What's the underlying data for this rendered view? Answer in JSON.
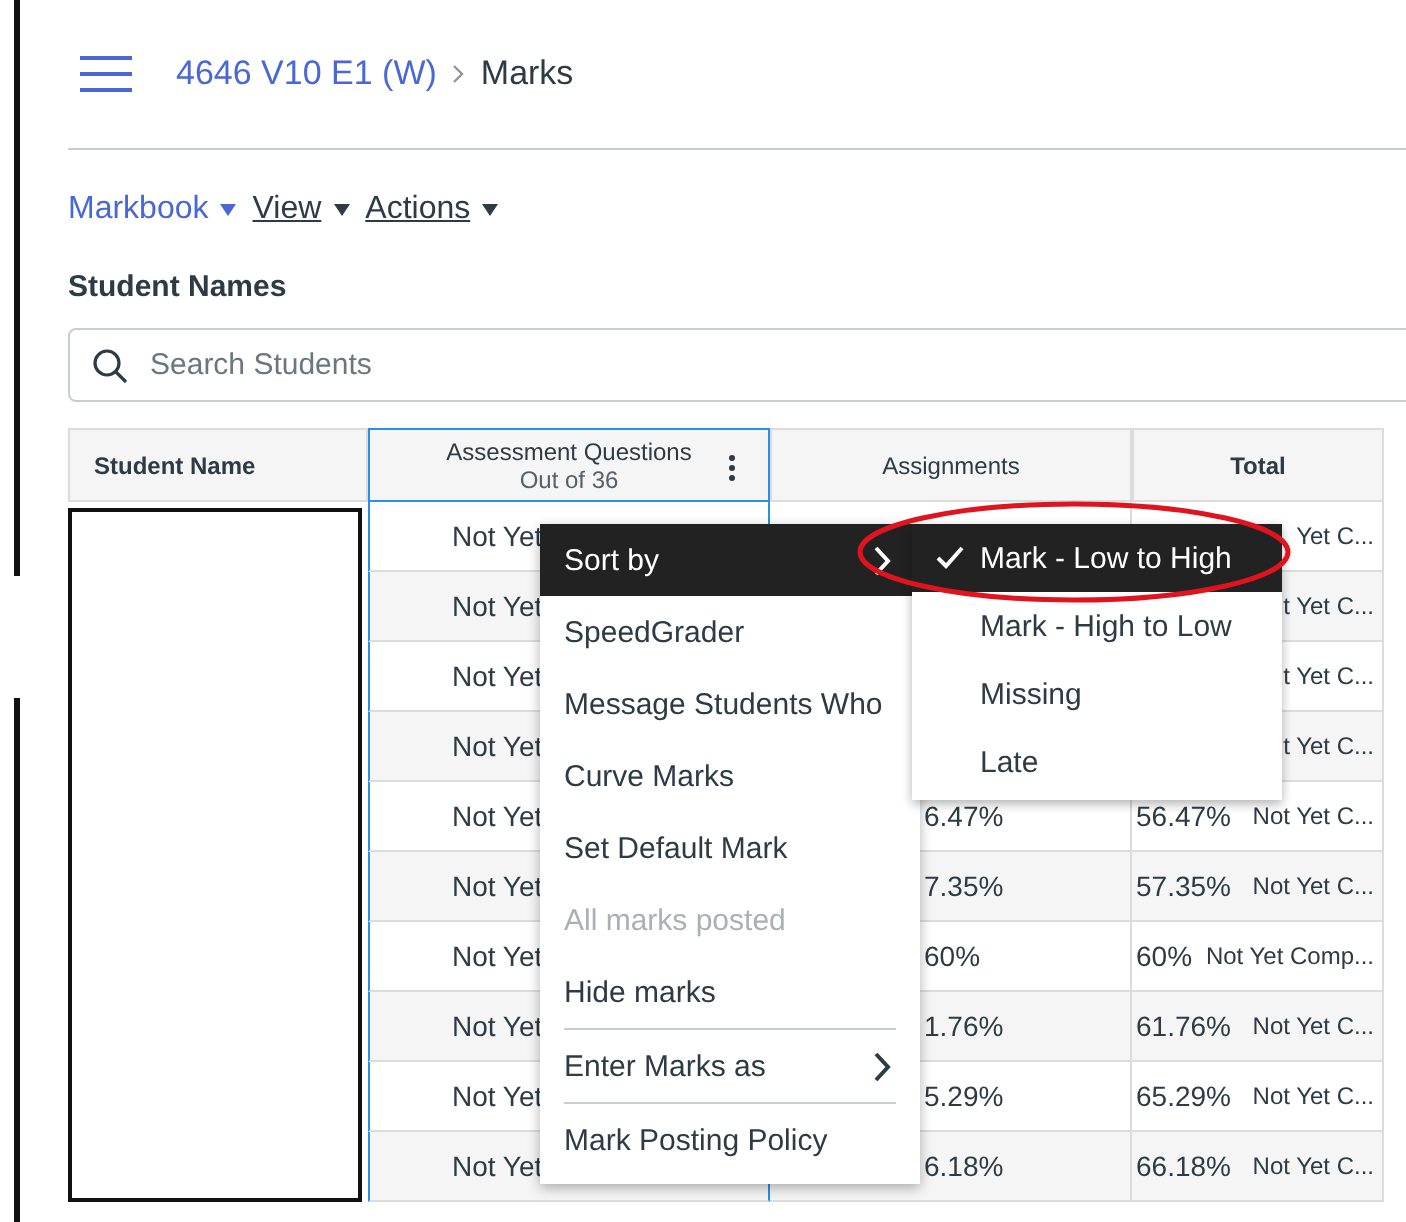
{
  "breadcrumb": {
    "course": "4646 V10 E1 (W)",
    "page": "Marks"
  },
  "toolbar": [
    {
      "label": "Markbook",
      "kind": "current"
    },
    {
      "label": "View",
      "kind": "menu"
    },
    {
      "label": "Actions",
      "kind": "menu"
    }
  ],
  "section_title": "Student Names",
  "search": {
    "placeholder": "Search Students"
  },
  "table": {
    "columns": [
      {
        "label": "Student Name",
        "bold": true,
        "selected": false
      },
      {
        "label": "Assessment Questions",
        "sublabel": "Out of 36",
        "bold": false,
        "selected": true
      },
      {
        "label": "Assignments",
        "bold": false,
        "selected": false
      },
      {
        "label": "Total",
        "bold": true,
        "selected": false
      }
    ],
    "rows": [
      {
        "assessment": "Not Yet",
        "assignments": "",
        "total": "",
        "total_status": "Yet C..."
      },
      {
        "assessment": "Not Yet",
        "assignments": "",
        "total": "",
        "total_status": "t Yet C..."
      },
      {
        "assessment": "Not Yet",
        "assignments": "",
        "total": "",
        "total_status": "t Yet C..."
      },
      {
        "assessment": "Not Yet",
        "assignments": "",
        "total": "",
        "total_status": "t Yet C..."
      },
      {
        "assessment": "Not Yet",
        "assignments": "6.47%",
        "total": "56.47%",
        "total_status": "Not Yet C..."
      },
      {
        "assessment": "Not Yet",
        "assignments": "7.35%",
        "total": "57.35%",
        "total_status": "Not Yet C..."
      },
      {
        "assessment": "Not Yet",
        "assignments": "60%",
        "total": "60%",
        "total_status": "Not Yet Comp..."
      },
      {
        "assessment": "Not Yet",
        "assignments": "1.76%",
        "total": "61.76%",
        "total_status": "Not Yet C..."
      },
      {
        "assessment": "Not Yet",
        "assignments": "5.29%",
        "total": "65.29%",
        "total_status": "Not Yet C..."
      },
      {
        "assessment": "Not Yet",
        "assignments": "6.18%",
        "total": "66.18%",
        "total_status": "Not Yet C..."
      }
    ]
  },
  "column_menu": {
    "items": [
      {
        "label": "Sort by",
        "highlighted": true,
        "disabled": false,
        "has_submenu": true,
        "divider_before": false
      },
      {
        "label": "SpeedGrader",
        "highlighted": false,
        "disabled": false,
        "has_submenu": false,
        "divider_before": false
      },
      {
        "label": "Message Students Who",
        "highlighted": false,
        "disabled": false,
        "has_submenu": false,
        "divider_before": false
      },
      {
        "label": "Curve Marks",
        "highlighted": false,
        "disabled": false,
        "has_submenu": false,
        "divider_before": false
      },
      {
        "label": "Set Default Mark",
        "highlighted": false,
        "disabled": false,
        "has_submenu": false,
        "divider_before": false
      },
      {
        "label": "All marks posted",
        "highlighted": false,
        "disabled": true,
        "has_submenu": false,
        "divider_before": false
      },
      {
        "label": "Hide marks",
        "highlighted": false,
        "disabled": false,
        "has_submenu": false,
        "divider_before": false
      },
      {
        "label": "Enter Marks as",
        "highlighted": false,
        "disabled": false,
        "has_submenu": true,
        "divider_before": true
      },
      {
        "label": "Mark Posting Policy",
        "highlighted": false,
        "disabled": false,
        "has_submenu": false,
        "divider_before": true
      }
    ]
  },
  "sort_menu": {
    "items": [
      {
        "label": "Mark - Low to High",
        "selected": true
      },
      {
        "label": "Mark - High to Low",
        "selected": false
      },
      {
        "label": "Missing",
        "selected": false
      },
      {
        "label": "Late",
        "selected": false
      }
    ]
  }
}
